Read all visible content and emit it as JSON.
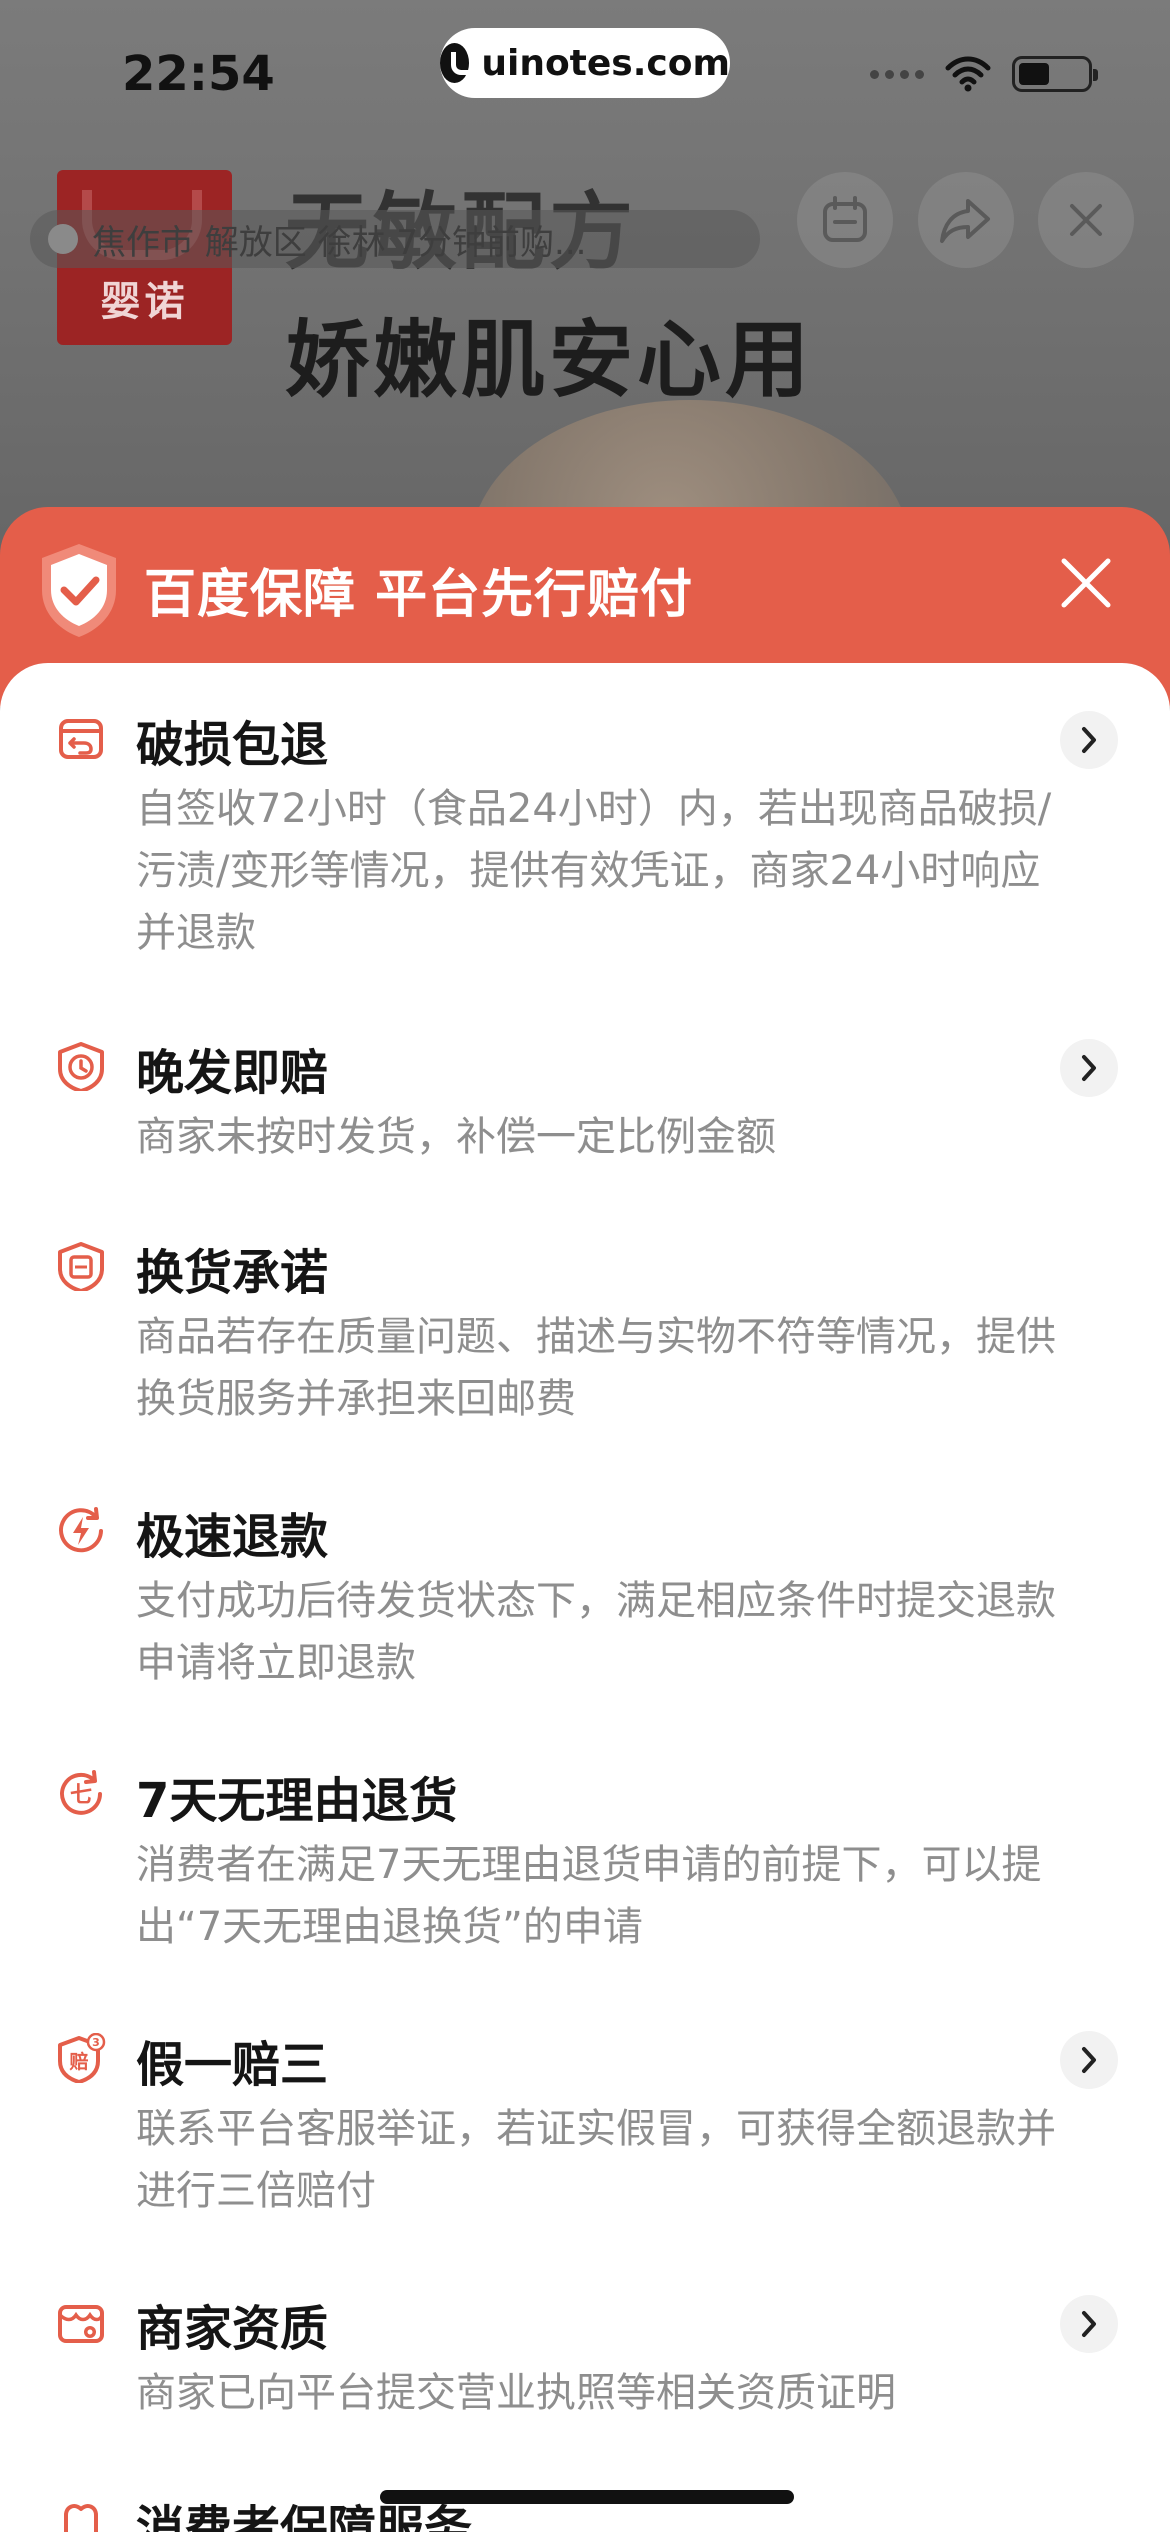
{
  "status_bar": {
    "time": "22:54",
    "watermark": "uinotes.com"
  },
  "product_page": {
    "headline_line1": "无敏配方",
    "headline_line2": "娇嫩肌安心用",
    "brand_logo_text": "婴诺",
    "location": "焦作市 解放区 徐林 7分钟前购..."
  },
  "sheet": {
    "title": "百度保障 平台先行赔付",
    "items": [
      {
        "title": "破损包退",
        "desc": "自签收72小时（食品24小时）内，若出现商品破损/污渍/变形等情况，提供有效凭证，商家24小时响应并退款",
        "icon": "return-box-icon",
        "has_chevron": true
      },
      {
        "title": "晚发即赔",
        "desc": "商家未按时发货，补偿一定比例金额",
        "icon": "shield-clock-icon",
        "has_chevron": true
      },
      {
        "title": "换货承诺",
        "desc": "商品若存在质量问题、描述与实物不符等情况，提供换货服务并承担来回邮费",
        "icon": "shield-exchange-icon",
        "has_chevron": false
      },
      {
        "title": "极速退款",
        "desc": "支付成功后待发货状态下，满足相应条件时提交退款申请将立即退款",
        "icon": "lightning-refund-icon",
        "has_chevron": false
      },
      {
        "title": "7天无理由退货",
        "desc": "消费者在满足7天无理由退货申请的前提下，可以提出“7天无理由退换货”的申请",
        "icon": "seven-day-return-icon",
        "icon_text": "七",
        "has_chevron": false
      },
      {
        "title": "假一赔三",
        "desc": "联系平台客服举证，若证实假冒，可获得全额退款并进行三倍赔付",
        "icon": "shield-compensate-icon",
        "icon_text": "赔",
        "icon_badge": "3",
        "has_chevron": true
      },
      {
        "title": "商家资质",
        "desc": "商家已向平台提交营业执照等相关资质证明",
        "icon": "store-license-icon",
        "has_chevron": true
      },
      {
        "title": "消费者保障服务",
        "desc": "",
        "icon": "consumer-protection-icon",
        "has_chevron": false
      }
    ]
  },
  "colors": {
    "accent": "#e45e4a",
    "title_text": "#151515",
    "desc_text": "#8e8e8e",
    "overlay": "#717171"
  }
}
